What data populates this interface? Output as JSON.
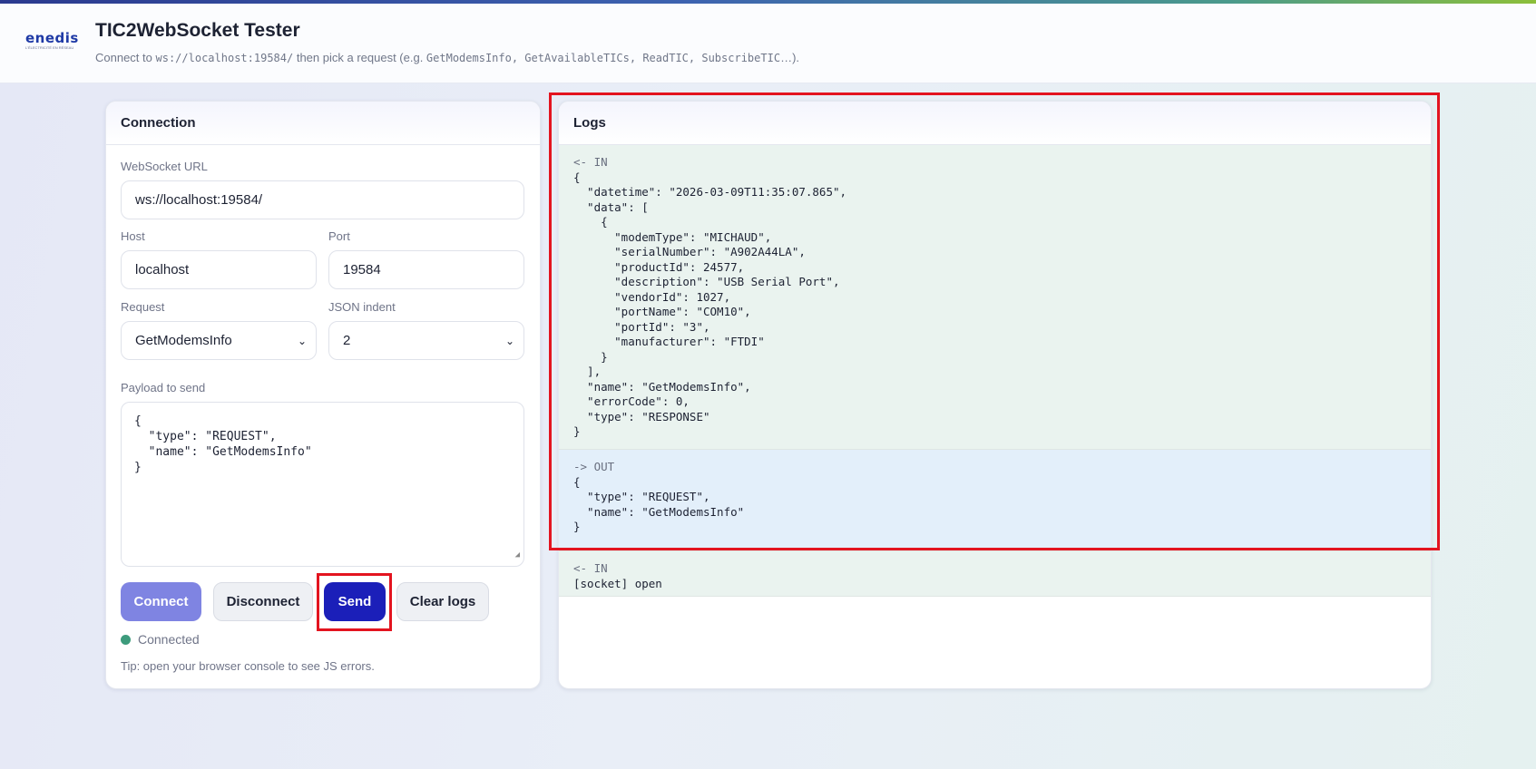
{
  "header": {
    "logo_text": "enedis",
    "logo_tagline": "L'ÉLECTRICITÉ EN RÉSEAU",
    "title": "TIC2WebSocket Tester",
    "subtitle_prefix": "Connect to ",
    "subtitle_url": "ws://localhost:19584/",
    "subtitle_middle": " then pick a request (e.g. ",
    "subtitle_examples": "GetModemsInfo, GetAvailableTICs, ReadTIC, SubscribeTIC",
    "subtitle_suffix": "…)."
  },
  "connection": {
    "title": "Connection",
    "url_label": "WebSocket URL",
    "url_value": "ws://localhost:19584/",
    "host_label": "Host",
    "host_value": "localhost",
    "port_label": "Port",
    "port_value": "19584",
    "request_label": "Request",
    "request_value": "GetModemsInfo",
    "indent_label": "JSON indent",
    "indent_value": "2",
    "payload_label": "Payload to send",
    "payload_value": "{\n  \"type\": \"REQUEST\",\n  \"name\": \"GetModemsInfo\"\n}",
    "buttons": {
      "connect": "Connect",
      "disconnect": "Disconnect",
      "send": "Send",
      "clear": "Clear logs"
    },
    "status_text": "Connected",
    "tip": "Tip: open your browser console to see JS errors."
  },
  "logs": {
    "title": "Logs",
    "entries": [
      {
        "direction": "<- IN",
        "body": "{\n  \"datetime\": \"2026-03-09T11:35:07.865\",\n  \"data\": [\n    {\n      \"modemType\": \"MICHAUD\",\n      \"serialNumber\": \"A902A44LA\",\n      \"productId\": 24577,\n      \"description\": \"USB Serial Port\",\n      \"vendorId\": 1027,\n      \"portName\": \"COM10\",\n      \"portId\": \"3\",\n      \"manufacturer\": \"FTDI\"\n    }\n  ],\n  \"name\": \"GetModemsInfo\",\n  \"errorCode\": 0,\n  \"type\": \"RESPONSE\"\n}"
      },
      {
        "direction": "-> OUT",
        "body": "{\n  \"type\": \"REQUEST\",\n  \"name\": \"GetModemsInfo\"\n}"
      },
      {
        "direction": "<- IN",
        "body": "[socket] open"
      }
    ]
  },
  "colors": {
    "accent": "#1b1fb9",
    "connect_button": "#7f84e2",
    "status_connected": "#3d9b7c",
    "highlight": "#e3141f"
  }
}
